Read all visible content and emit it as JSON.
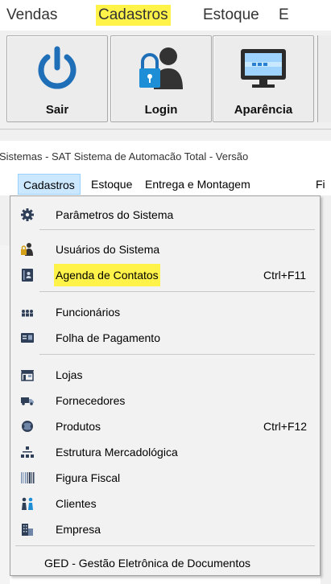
{
  "top_menubar": {
    "items": [
      "Vendas",
      "Cadastros",
      "Estoque",
      "E"
    ]
  },
  "toolbar": {
    "buttons": [
      {
        "label": "Sair",
        "icon": "power-icon"
      },
      {
        "label": "Login",
        "icon": "user-lock-icon"
      },
      {
        "label": "Aparência",
        "icon": "monitor-icon"
      }
    ]
  },
  "window_title": "Sistemas - SAT Sistema de Automação Total - Versão",
  "menubar": {
    "items": [
      "Cadastros",
      "Estoque",
      "Entrega e Montagem",
      "Fi"
    ]
  },
  "dropdown": {
    "items": [
      {
        "label": "Parâmetros do Sistema",
        "icon": "gear-icon",
        "shortcut": ""
      },
      {
        "label": "Usuários do Sistema",
        "icon": "users-icon",
        "shortcut": ""
      },
      {
        "label": "Agenda de Contatos",
        "icon": "address-book-icon",
        "shortcut": "Ctrl+F11"
      },
      {
        "label": "Funcionários",
        "icon": "employees-icon",
        "shortcut": ""
      },
      {
        "label": "Folha de Pagamento",
        "icon": "payroll-icon",
        "shortcut": ""
      },
      {
        "label": "Lojas",
        "icon": "store-icon",
        "shortcut": ""
      },
      {
        "label": "Fornecedores",
        "icon": "truck-icon",
        "shortcut": ""
      },
      {
        "label": "Produtos",
        "icon": "products-icon",
        "shortcut": "Ctrl+F12"
      },
      {
        "label": "Estrutura Mercadológica",
        "icon": "hierarchy-icon",
        "shortcut": ""
      },
      {
        "label": "Figura Fiscal",
        "icon": "barcode-icon",
        "shortcut": ""
      },
      {
        "label": "Clientes",
        "icon": "clients-icon",
        "shortcut": ""
      },
      {
        "label": "Empresa",
        "icon": "building-icon",
        "shortcut": ""
      },
      {
        "label": "GED - Gestão Eletrônica de Documentos",
        "icon": "",
        "shortcut": ""
      }
    ]
  },
  "colors": {
    "highlight": "#fff34a",
    "menu_active": "#cce8ff",
    "accent_blue": "#1e6fb8"
  }
}
